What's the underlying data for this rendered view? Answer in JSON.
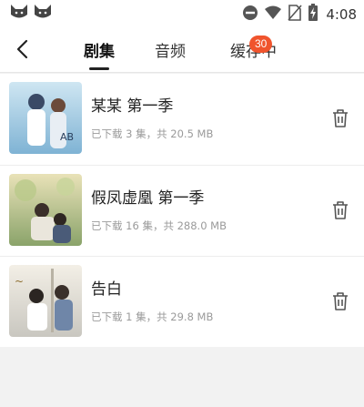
{
  "status_bar": {
    "time": "4:08",
    "icons": [
      "cat-app-icon",
      "cat-app-icon",
      "do-not-disturb-icon",
      "wifi-icon",
      "no-sim-icon",
      "battery-charging-icon"
    ]
  },
  "header": {
    "back_icon": "back-arrow-icon",
    "tabs": [
      {
        "label": "剧集",
        "active": true
      },
      {
        "label": "音频",
        "active": false
      },
      {
        "label": "缓存中",
        "active": false,
        "badge": "30"
      }
    ]
  },
  "items": [
    {
      "title": "某某 第一季",
      "meta": "已下载 3 集，共 20.5 MB",
      "delete_icon": "trash-icon"
    },
    {
      "title": "假凤虚凰 第一季",
      "meta": "已下载 16 集，共 288.0 MB",
      "delete_icon": "trash-icon"
    },
    {
      "title": "告白",
      "meta": "已下载 1 集，共 29.8 MB",
      "delete_icon": "trash-icon"
    }
  ],
  "colors": {
    "accent": "#f0542d",
    "background": "#f2f2f2",
    "card": "#ffffff",
    "secondary_text": "#9a9a9a"
  }
}
